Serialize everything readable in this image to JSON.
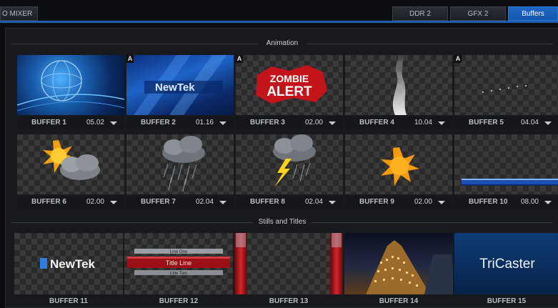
{
  "tabs": {
    "left_label": "O MIXER",
    "ddr2": "DDR 2",
    "gfx2": "GFX 2",
    "buffers": "Buffers"
  },
  "sections": {
    "animation": "Animation",
    "stills": "Stills and Titles"
  },
  "animation_buffers": [
    {
      "name": "BUFFER 1",
      "duration": "05.02",
      "badge": "",
      "icon": "globe"
    },
    {
      "name": "BUFFER 2",
      "duration": "01.16",
      "badge": "A",
      "icon": "newtek-logo"
    },
    {
      "name": "BUFFER 3",
      "duration": "02.00",
      "badge": "A",
      "icon": "zombie-alert"
    },
    {
      "name": "BUFFER 4",
      "duration": "10.04",
      "badge": "",
      "icon": "smoke"
    },
    {
      "name": "BUFFER 5",
      "duration": "04.04",
      "badge": "A",
      "icon": "sparkles"
    },
    {
      "name": "BUFFER 6",
      "duration": "02.00",
      "badge": "",
      "icon": "sun-cloud"
    },
    {
      "name": "BUFFER 7",
      "duration": "02.04",
      "badge": "",
      "icon": "rain-cloud"
    },
    {
      "name": "BUFFER 8",
      "duration": "02.04",
      "badge": "",
      "icon": "storm-cloud"
    },
    {
      "name": "BUFFER 9",
      "duration": "02.00",
      "badge": "",
      "icon": "sun"
    },
    {
      "name": "BUFFER 10",
      "duration": "08.00",
      "badge": "",
      "icon": "lower-third"
    }
  ],
  "still_buffers": [
    {
      "name": "BUFFER 11",
      "icon": "newtek-logo",
      "text": "NewTek"
    },
    {
      "name": "BUFFER 12",
      "icon": "title-bar",
      "line1": "Line One",
      "title": "Title Line",
      "line2": "Line Two"
    },
    {
      "name": "BUFFER 13",
      "icon": "red-pillars"
    },
    {
      "name": "BUFFER 14",
      "icon": "night-building"
    },
    {
      "name": "BUFFER 15",
      "icon": "tricaster-logo",
      "text": "TriCaster"
    }
  ],
  "colors": {
    "accent_blue": "#1f5fae",
    "active_tab": "#1457ad",
    "zombie_red": "#d0141a"
  }
}
